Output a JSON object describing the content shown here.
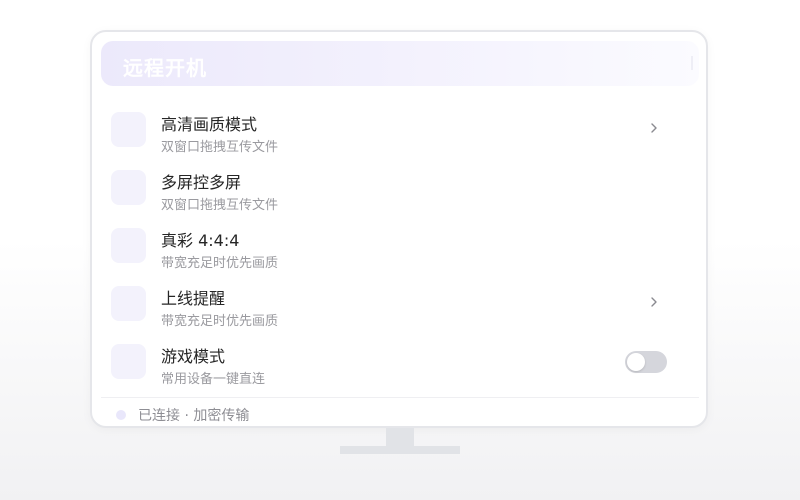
{
  "header": {
    "title": "远程开机"
  },
  "settings": {
    "items": [
      {
        "title": "高清画质模式",
        "subtitle": "双窗口拖拽互传文件",
        "control": "chevron"
      },
      {
        "title": "多屏控多屏",
        "subtitle": "双窗口拖拽互传文件",
        "control": "none"
      },
      {
        "title": "真彩 4:4:4",
        "subtitle": "带宽充足时优先画质",
        "control": "none"
      },
      {
        "title": "上线提醒",
        "subtitle": "带宽充足时优先画质",
        "control": "chevron"
      },
      {
        "title": "游戏模式",
        "subtitle": "常用设备一键直连",
        "control": "toggle",
        "toggle_on": false
      }
    ]
  },
  "status": {
    "text": "已连接 · 加密传输"
  },
  "colors": {
    "accent_tint": "#ece9fb",
    "toggle_off": "#d5d6dc",
    "title_text": "#262626",
    "subtitle_text": "#9a9a9f"
  },
  "icons": [
    "chevron-right-icon",
    "status-dot-icon"
  ]
}
